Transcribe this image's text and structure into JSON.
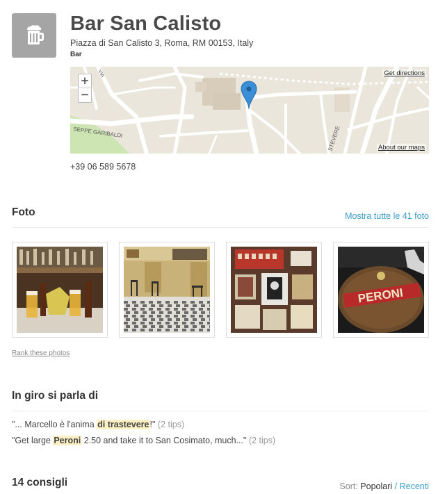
{
  "venue": {
    "name": "Bar San Calisto",
    "address": "Piazza di San Calisto 3, Roma, RM 00153, Italy",
    "category": "Bar",
    "phone": "+39 06 589 5678",
    "icon": "beer-mug-icon"
  },
  "map": {
    "get_directions": "Get directions",
    "about_maps": "About our maps",
    "zoom_in": "+",
    "zoom_out": "−",
    "street_label_1": "SEPPE GARIBALDI",
    "street_label_2": "VIA",
    "street_label_3": "STEVERE",
    "pin_icon": "map-pin-icon"
  },
  "photos": {
    "title": "Foto",
    "see_all": "Mostra tutte le 41 foto",
    "rank_link": "Rank these photos",
    "sign_text": "PERONI"
  },
  "talk": {
    "title": "In giro si parla di",
    "quotes": [
      {
        "before": "\"... Marcello è l'anima ",
        "highlight": "di trastevere",
        "after": "!\"",
        "count": "(2 tips)"
      },
      {
        "before": "\"Get large ",
        "highlight": "Peroni",
        "after": " 2.50 and take it to San Cosimato, much...\"",
        "count": "(2 tips)"
      }
    ]
  },
  "tips": {
    "title": "14 consigli",
    "sort_label": "Sort:",
    "sort_popular": "Popolari",
    "sort_separator": "/",
    "sort_recent": "Recenti"
  },
  "colors": {
    "link": "#3a9dc8",
    "highlight": "#fcf0c4",
    "pin": "#3b8fd6"
  }
}
